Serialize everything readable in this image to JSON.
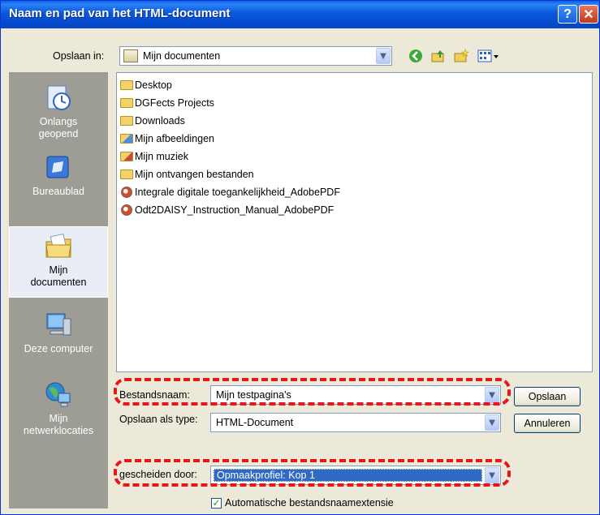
{
  "window": {
    "title": "Naam en pad van het HTML-document",
    "help_label": "?",
    "close_label": "✕"
  },
  "toolbar": {
    "save_in_label": "Opslaan in:",
    "save_in_value": "Mijn documenten",
    "back_icon": "back-arrow-icon",
    "up_icon": "up-folder-icon",
    "new_folder_icon": "new-folder-icon",
    "views_icon": "views-menu-icon"
  },
  "places": [
    {
      "label_line1": "Onlangs",
      "label_line2": "geopend",
      "icon": "recent-icon"
    },
    {
      "label_line1": "Bureaublad",
      "label_line2": "",
      "icon": "desktop-icon"
    },
    {
      "label_line1": "Mijn",
      "label_line2": "documenten",
      "icon": "my-documents-icon",
      "selected": true
    },
    {
      "label_line1": "Deze computer",
      "label_line2": "",
      "icon": "computer-icon"
    },
    {
      "label_line1": "Mijn",
      "label_line2": "netwerklocaties",
      "icon": "network-icon"
    }
  ],
  "files": [
    {
      "name": "Desktop",
      "type": "folder"
    },
    {
      "name": "DGFects Projects",
      "type": "folder"
    },
    {
      "name": "Downloads",
      "type": "folder"
    },
    {
      "name": "Mijn afbeeldingen",
      "type": "pictures-folder"
    },
    {
      "name": "Mijn muziek",
      "type": "music-folder"
    },
    {
      "name": "Mijn ontvangen bestanden",
      "type": "folder"
    },
    {
      "name": "Integrale digitale toegankelijkheid_AdobePDF",
      "type": "pdf"
    },
    {
      "name": "Odt2DAISY_Instruction_Manual_AdobePDF",
      "type": "pdf"
    }
  ],
  "form": {
    "filename_label": "Bestandsnaam:",
    "filename_value": "Mijn testpagina's",
    "type_label": "Opslaan als type:",
    "type_value": "HTML-Document",
    "separated_label": "gescheiden door:",
    "separated_value": "Opmaakprofiel: Kop 1",
    "auto_ext_label": "Automatische bestandsnaamextensie",
    "auto_ext_checked": true
  },
  "buttons": {
    "save": "Opslaan",
    "cancel": "Annuleren"
  },
  "colors": {
    "titlebar": "#0a58dd",
    "highlight": "#e8151a",
    "selection": "#316ac5"
  }
}
